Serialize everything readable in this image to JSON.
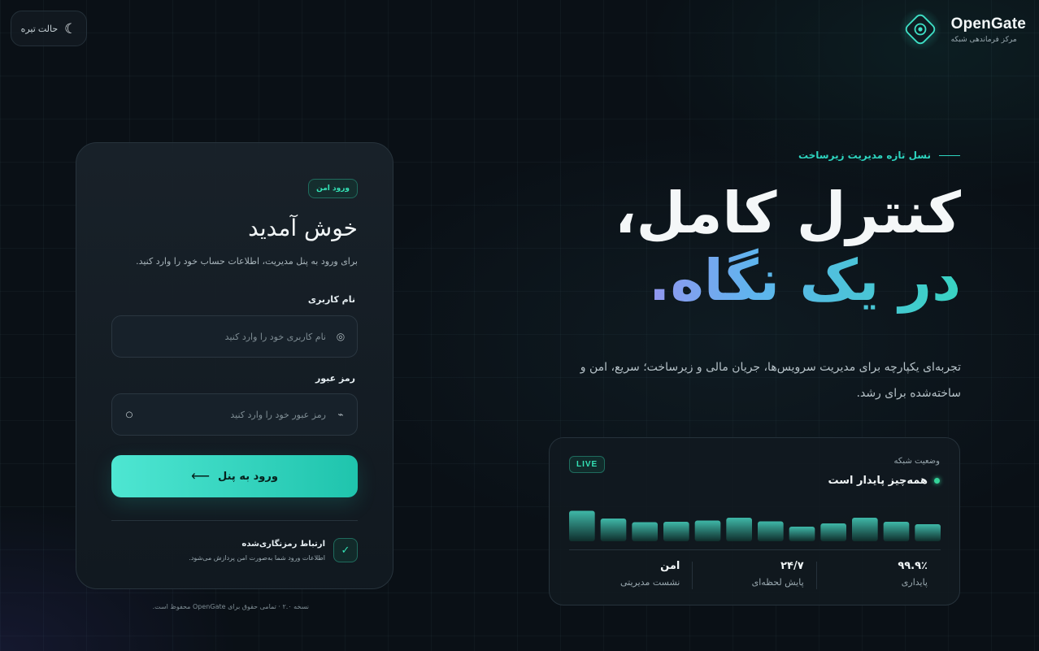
{
  "brand": {
    "name": "OpenGate",
    "subtitle": "مرکز فرماندهی شبکه"
  },
  "theme_toggle": {
    "label": "حالت تیره",
    "icon": "moon-icon"
  },
  "hero": {
    "kicker": "نسل تازه مدیریت زیرساخت",
    "title_line1": "کنترل کامل،",
    "title_line2": "در یک نگاه.",
    "description": "تجربه‌ای یکپارچه برای مدیریت سرویس‌ها، جریان مالی و زیرساخت؛ سریع، امن و ساخته‌شده برای رشد."
  },
  "status": {
    "title": "وضعیت شبکه",
    "state": "همه‌چیز پایدار است",
    "live": "LIVE",
    "stats": [
      {
        "value": "۹۹.۹٪",
        "label": "پایداری"
      },
      {
        "value": "۲۴/۷",
        "label": "پایش لحظه‌ای"
      },
      {
        "value": "امن",
        "label": "نشست مدیریتی"
      }
    ]
  },
  "chart_data": {
    "type": "bar",
    "values": [
      0.42,
      0.48,
      0.58,
      0.44,
      0.36,
      0.49,
      0.58,
      0.51,
      0.48,
      0.47,
      0.56,
      0.75
    ],
    "colors": {
      "top": "#3fb8a8",
      "bottom": "#0f2e2c"
    }
  },
  "login": {
    "badge": "ورود امن",
    "title": "خوش آمدید",
    "subtitle": "برای ورود به پنل مدیریت، اطلاعات حساب خود را وارد کنید.",
    "username_label": "نام کاربری",
    "username_placeholder": "نام کاربری خود را وارد کنید",
    "password_label": "رمز عبور",
    "password_placeholder": "رمز عبور خود را وارد کنید",
    "submit_label": "ورود به پنل",
    "encryption_title": "ارتباط رمزنگاری‌شده",
    "encryption_desc": "اطلاعات ورود شما به‌صورت امن پردازش می‌شود."
  },
  "footer": {
    "note": "نسخه ۲.۰ · تمامی حقوق برای OpenGate محفوظ است."
  },
  "colors": {
    "accent": "#2dd4bf",
    "background": "#0a1016",
    "card": "#111920"
  }
}
